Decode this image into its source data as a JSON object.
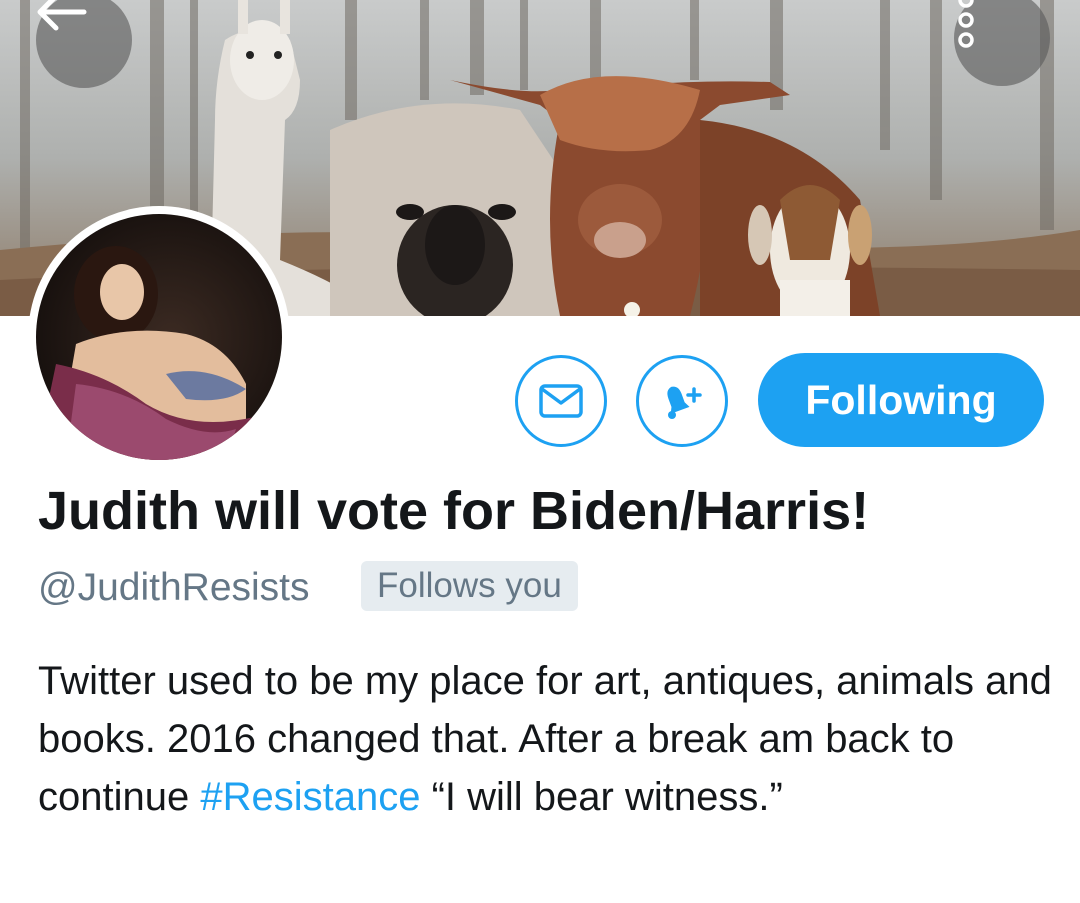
{
  "header": {
    "back_icon": "arrow-left-icon",
    "more_icon": "more-vertical-icon"
  },
  "profile": {
    "display_name": "Judith will vote for Biden/Harris!",
    "handle": "@JudithResists",
    "follows_you_badge": "Follows you",
    "bio_parts": {
      "before_hashtag": "Twitter used to be my place for art, antiques, animals and books. 2016 changed that. After a break am back to continue ",
      "hashtag": "#Resistance",
      "after_hashtag": " “I will bear witness.”"
    }
  },
  "actions": {
    "dm_icon": "envelope-icon",
    "notify_icon": "bell-plus-icon",
    "following_label": "Following"
  },
  "colors": {
    "accent": "#1da1f2",
    "text_primary": "#14171a",
    "text_secondary": "#657786",
    "badge_bg": "#e6ecf0"
  }
}
